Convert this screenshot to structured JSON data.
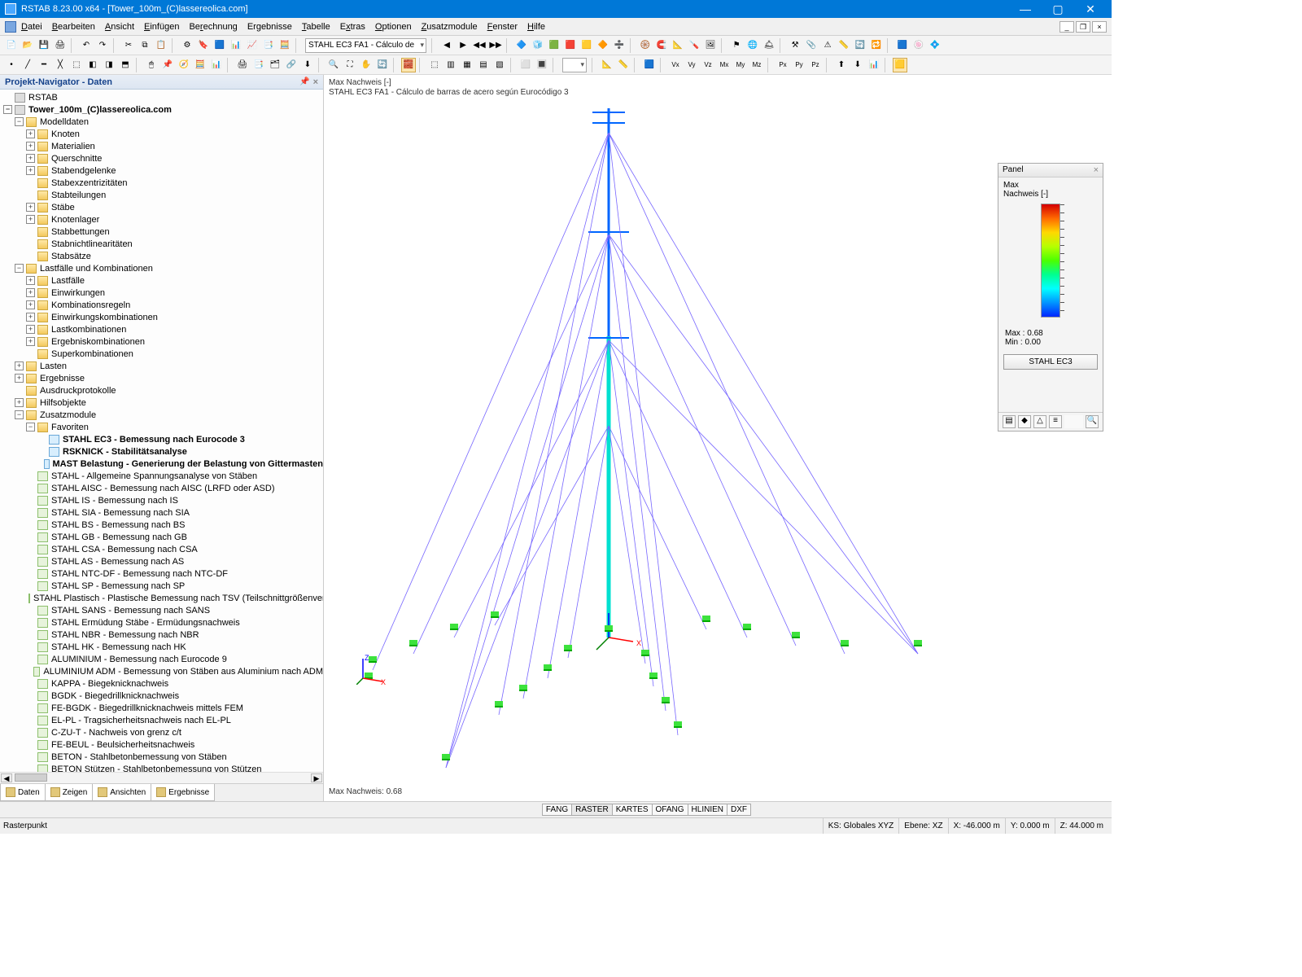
{
  "title": "RSTAB 8.23.00 x64 - [Tower_100m_(C)lassereolica.com]",
  "menu": [
    "Datei",
    "Bearbeiten",
    "Ansicht",
    "Einfügen",
    "Berechnung",
    "Ergebnisse",
    "Tabelle",
    "Extras",
    "Optionen",
    "Zusatzmodule",
    "Fenster",
    "Hilfe"
  ],
  "toolbar_combo": "STAHL EC3 FA1 - Cálculo de",
  "navigator": {
    "title": "Projekt-Navigator - Daten",
    "root": "RSTAB",
    "project": "Tower_100m_(C)lassereolica.com",
    "modelldaten": {
      "label": "Modelldaten",
      "children": [
        "Knoten",
        "Materialien",
        "Querschnitte",
        "Stabendgelenke",
        "Stabexzentrizitäten",
        "Stabteilungen",
        "Stäbe",
        "Knotenlager",
        "Stabbettungen",
        "Stabnichtlinearitäten",
        "Stabsätze"
      ]
    },
    "lastfaelle": {
      "label": "Lastfälle und Kombinationen",
      "children": [
        "Lastfälle",
        "Einwirkungen",
        "Kombinationsregeln",
        "Einwirkungskombinationen",
        "Lastkombinationen",
        "Ergebniskombinationen",
        "Superkombinationen"
      ]
    },
    "simple": [
      "Lasten",
      "Ergebnisse",
      "Ausdruckprotokolle",
      "Hilfsobjekte"
    ],
    "zusatz": {
      "label": "Zusatzmodule",
      "fav": "Favoriten",
      "fav_items": [
        "STAHL EC3 - Bemessung nach Eurocode 3",
        "RSKNICK - Stabilitätsanalyse",
        "MAST Belastung - Generierung der Belastung von Gittermasten"
      ],
      "mods": [
        "STAHL - Allgemeine Spannungsanalyse von Stäben",
        "STAHL AISC - Bemessung nach AISC (LRFD oder ASD)",
        "STAHL IS - Bemessung nach IS",
        "STAHL SIA - Bemessung nach SIA",
        "STAHL BS - Bemessung nach BS",
        "STAHL GB - Bemessung nach GB",
        "STAHL CSA - Bemessung nach CSA",
        "STAHL AS - Bemessung nach AS",
        "STAHL NTC-DF - Bemessung nach NTC-DF",
        "STAHL SP - Bemessung nach SP",
        "STAHL Plastisch - Plastische Bemessung nach TSV (Teilschnittgrößenverfa",
        "STAHL SANS - Bemessung nach SANS",
        "STAHL Ermüdung Stäbe - Ermüdungsnachweis",
        "STAHL NBR - Bemessung nach NBR",
        "STAHL HK - Bemessung nach HK",
        "ALUMINIUM - Bemessung nach Eurocode 9",
        "ALUMINIUM ADM - Bemessung von Stäben aus Aluminium nach ADM",
        "KAPPA - Biegeknicknachweis",
        "BGDK - Biegedrillknicknachweis",
        "FE-BGDK - Biegedrillknicknachweis mittels FEM",
        "EL-PL - Tragsicherheitsnachweis nach EL-PL",
        "C-ZU-T - Nachweis von grenz c/t",
        "FE-BEUL - Beulsicherheitsnachweis",
        "BETON - Stahlbetonbemessung von Stäben",
        "BETON Stützen - Stahlbetonbemessung von Stützen"
      ]
    },
    "tabs": [
      "Daten",
      "Zeigen",
      "Ansichten",
      "Ergebnisse"
    ]
  },
  "viewport": {
    "line1": "Max Nachweis [-]",
    "line2": "STAHL EC3 FA1 - Cálculo de barras de acero según Eurocódigo 3",
    "max_label": "Max Nachweis: 0.68"
  },
  "panel": {
    "title": "Panel",
    "l1": "Max",
    "l2": "Nachweis [-]",
    "max": "Max  :  0.68",
    "min": "Min   :  0.00",
    "btn": "STAHL EC3"
  },
  "snap_tabs": [
    "FANG",
    "RASTER",
    "KARTES",
    "OFANG",
    "HLINIEN",
    "DXF"
  ],
  "status": {
    "left": "Rasterpunkt",
    "ks": "KS: Globales XYZ",
    "ebene": "Ebene: XZ",
    "x": "X: -46.000 m",
    "y": "Y: 0.000 m",
    "z": "Z: 44.000 m"
  }
}
